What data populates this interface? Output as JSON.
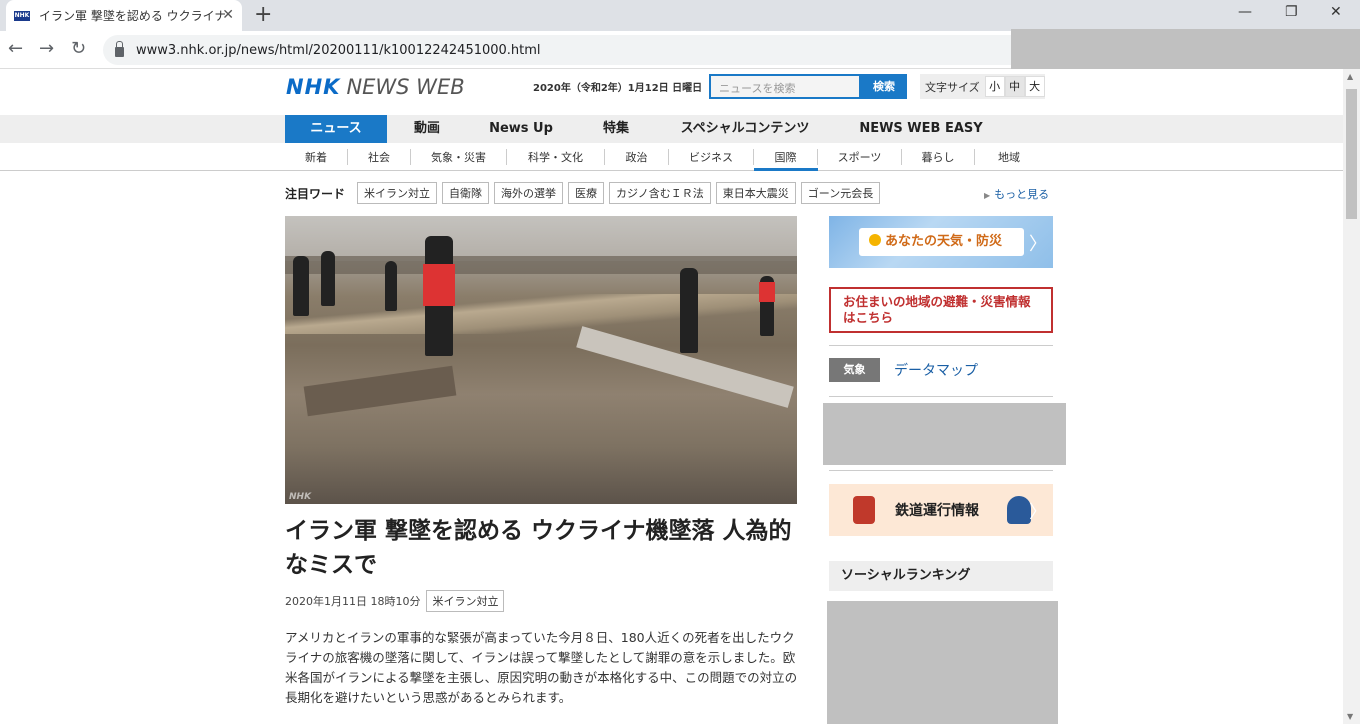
{
  "browser": {
    "tab_title": "イラン軍 撃墜を認める ウクライナ機",
    "favicon_text": "NHK",
    "close_tab": "✕",
    "new_tab": "+",
    "url": "www3.nhk.or.jp/news/html/20200111/k10012242451000.html",
    "back": "←",
    "forward": "→",
    "reload": "↻",
    "minimize": "—",
    "maximize": "❐",
    "close_window": "✕"
  },
  "header": {
    "logo_nhk": "NHK",
    "logo_newsweb": "NEWS WEB",
    "date": "2020年（令和2年）1月12日 日曜日",
    "search_placeholder": "ニュースを検索",
    "search_button": "検索",
    "font_size_label": "文字サイズ",
    "font_sizes": [
      "小",
      "中",
      "大"
    ],
    "font_size_selected": "中"
  },
  "global_nav": [
    {
      "label": "ニュース",
      "active": true
    },
    {
      "label": "動画",
      "active": false
    },
    {
      "label": "News Up",
      "active": false
    },
    {
      "label": "特集",
      "active": false
    },
    {
      "label": "スペシャルコンテンツ",
      "active": false
    },
    {
      "label": "NEWS WEB EASY",
      "active": false
    }
  ],
  "sub_nav": [
    {
      "label": "新着",
      "active": false
    },
    {
      "label": "社会",
      "active": false
    },
    {
      "label": "気象・災害",
      "active": false
    },
    {
      "label": "科学・文化",
      "active": false
    },
    {
      "label": "政治",
      "active": false
    },
    {
      "label": "ビジネス",
      "active": false
    },
    {
      "label": "国際",
      "active": true
    },
    {
      "label": "スポーツ",
      "active": false
    },
    {
      "label": "暮らし",
      "active": false
    },
    {
      "label": "地域",
      "active": false
    }
  ],
  "keywords": {
    "heading": "注目ワード",
    "tags": [
      "米イラン対立",
      "自衛隊",
      "海外の選挙",
      "医療",
      "カジノ含むＩＲ法",
      "東日本大震災",
      "ゴーン元会長"
    ],
    "more_label": "もっと見る"
  },
  "article": {
    "image_watermark": "NHK",
    "headline": "イラン軍 撃墜を認める ウクライナ機墜落 人為的なミスで",
    "datetime": "2020年1月11日 18時10分",
    "tag": "米イラン対立",
    "body": "アメリカとイランの軍事的な緊張が高まっていた今月８日、180人近くの死者を出したウクライナの旅客機の墜落に関して、イランは誤って撃墜したとして謝罪の意を示しました。欧米各国がイランによる撃墜を主張し、原因究明の動きが本格化する中、この問題での対立の長期化を避けたいという思惑があるとみられます。"
  },
  "sidebar": {
    "weather_label": "あなたの天気・防災",
    "evacuation_label": "お住まいの地域の避難・災害情報はこちら",
    "weather_badge": "気象",
    "datamap_label": "データマップ",
    "train_label": "鉄道運行情報",
    "ranking_label": "ソーシャルランキング",
    "chevron": "〉"
  },
  "colors": {
    "nhk_blue": "#1a79c7",
    "evac_red": "#c03030",
    "link": "#1a5fa5"
  }
}
